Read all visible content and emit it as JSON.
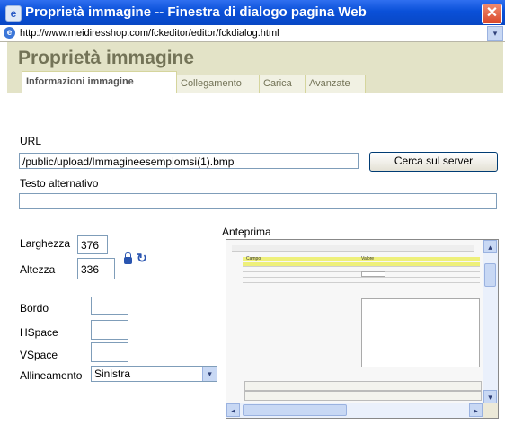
{
  "window": {
    "title": "Proprietà immagine -- Finestra di dialogo pagina Web",
    "close_glyph": "✕",
    "icon": "ie-page-icon"
  },
  "address": {
    "url": "http://www.meidiresshop.com/fckeditor/editor/fckdialog.html",
    "dropdown_glyph": "▾"
  },
  "dialog": {
    "title": "Proprietà immagine",
    "tabs": [
      {
        "label": "Informazioni immagine",
        "active": true
      },
      {
        "label": "Collegamento",
        "active": false
      },
      {
        "label": "Carica",
        "active": false
      },
      {
        "label": "Avanzate",
        "active": false
      }
    ]
  },
  "form": {
    "url_label": "URL",
    "url_value": "/public/upload/Immagineesempiomsi(1).bmp",
    "browse_button": "Cerca sul server",
    "alt_label": "Testo alternativo",
    "alt_value": "",
    "width_label": "Larghezza",
    "width_value": "376",
    "height_label": "Altezza",
    "height_value": "336",
    "lock_icon": "lock-icon",
    "reset_icon": "reset-size-icon",
    "reset_glyph": "↻",
    "border_label": "Bordo",
    "border_value": "",
    "hspace_label": "HSpace",
    "hspace_value": "",
    "vspace_label": "VSpace",
    "vspace_value": "",
    "align_label": "Allineamento",
    "align_value": "Sinistra",
    "select_arrow": "▾"
  },
  "preview": {
    "label": "Anteprima",
    "table_header": [
      "Campo",
      "Valore"
    ],
    "scroll_up": "▴",
    "scroll_down": "▾",
    "scroll_left": "◂",
    "scroll_right": "▸"
  }
}
